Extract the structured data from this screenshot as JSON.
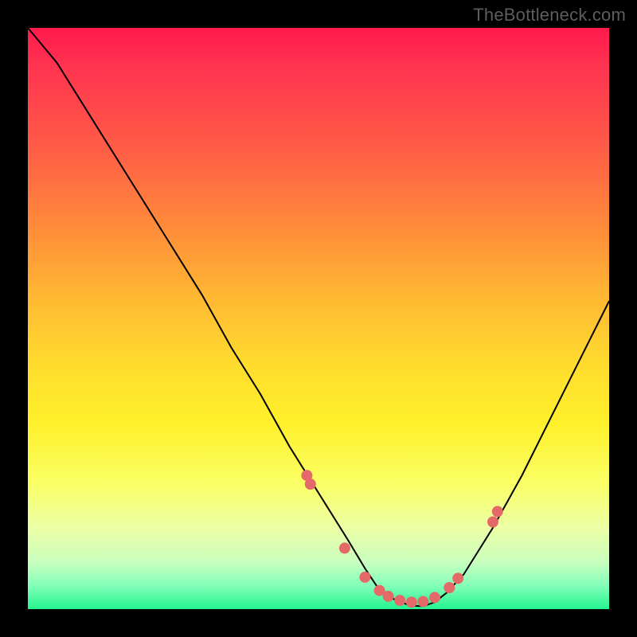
{
  "attribution": "TheBottleneck.com",
  "colors": {
    "frame": "#000000",
    "marker": "#e46a6a",
    "curve": "#000000",
    "gradient_top": "#ff1a4d",
    "gradient_bottom": "#23f58f"
  },
  "chart_data": {
    "type": "line",
    "title": "",
    "xlabel": "",
    "ylabel": "",
    "xlim": [
      0,
      100
    ],
    "ylim": [
      0,
      100
    ],
    "grid": false,
    "legend": "none",
    "series": [
      {
        "name": "bottleneck-curve",
        "x": [
          0,
          5,
          10,
          15,
          20,
          25,
          30,
          35,
          40,
          45,
          50,
          55,
          58,
          60,
          62,
          64,
          66,
          68,
          70,
          72,
          75,
          80,
          85,
          90,
          95,
          100
        ],
        "y": [
          100,
          94,
          86,
          78,
          70,
          62,
          54,
          45,
          37,
          28,
          20,
          12,
          7,
          4,
          2.2,
          1.2,
          0.6,
          0.5,
          1.2,
          2.8,
          6,
          14,
          23,
          33,
          43,
          53
        ]
      }
    ],
    "markers": {
      "name": "sample-points",
      "x": [
        48,
        48.6,
        54.5,
        58,
        60.5,
        62,
        64,
        66,
        68,
        70,
        72.5,
        74,
        80,
        80.8
      ],
      "y": [
        23,
        21.5,
        10.5,
        5.5,
        3.2,
        2.2,
        1.5,
        1.2,
        1.3,
        2,
        3.7,
        5.3,
        15,
        16.8
      ]
    },
    "annotations": []
  }
}
